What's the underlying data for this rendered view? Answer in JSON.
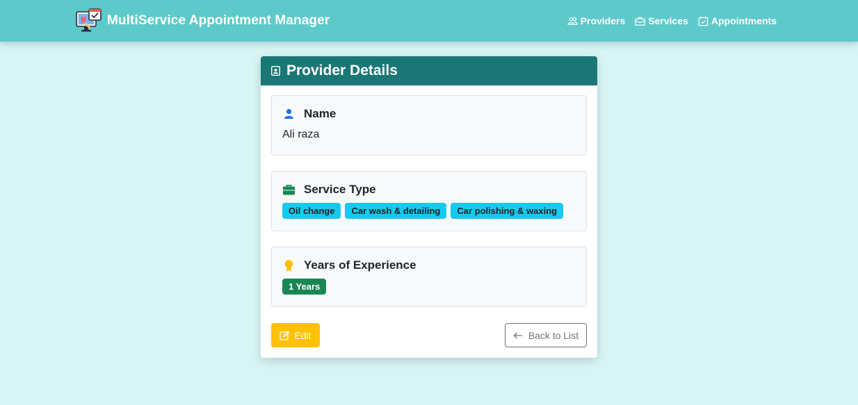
{
  "app": {
    "title": "MultiService Appointment Manager",
    "logo_icon": "computer-calendar-logo-icon"
  },
  "nav": {
    "items": [
      {
        "label": "Providers",
        "icon": "people-icon"
      },
      {
        "label": "Services",
        "icon": "briefcase-icon"
      },
      {
        "label": "Appointments",
        "icon": "calendar-check-icon"
      }
    ]
  },
  "card": {
    "title": "Provider Details",
    "icon": "person-badge-icon",
    "name_section": {
      "title": "Name",
      "value": "Ali raza",
      "icon": "person-icon"
    },
    "service_section": {
      "title": "Service Type",
      "icon": "briefcase-icon",
      "badges": [
        "Oil change",
        "Car wash & detailing",
        "Car polishing & waxing"
      ]
    },
    "experience_section": {
      "title": "Years of Experience",
      "value": "1 Years",
      "icon": "award-icon"
    },
    "buttons": {
      "edit": "Edit",
      "back": "Back to List"
    }
  },
  "colors": {
    "navbar": "#5ec9ca",
    "background": "#d7f5f4",
    "card_header": "#1b7776",
    "badge_info": "#17c9ee",
    "badge_success": "#198754",
    "edit_button": "#ffc107"
  }
}
